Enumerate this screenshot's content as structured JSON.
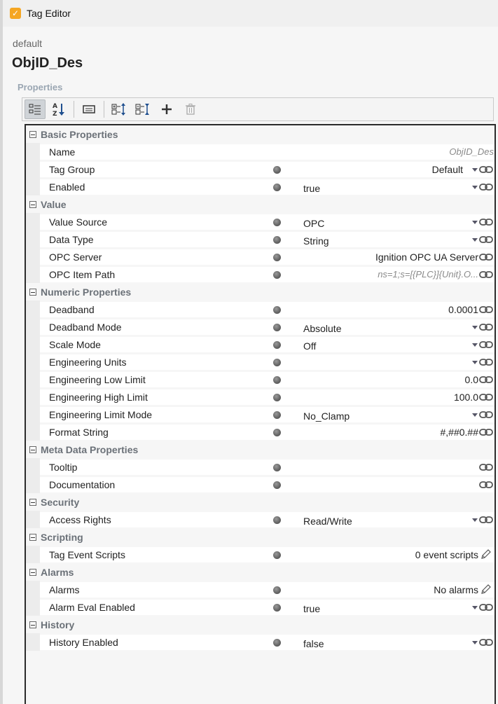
{
  "window": {
    "title": "Tag Editor",
    "app_icon_glyph": "✓"
  },
  "header": {
    "provider": "default",
    "tag_name": "ObjID_Des",
    "section_label": "Properties"
  },
  "toolbar": {
    "buttons": [
      {
        "name": "categorized-view-icon",
        "active": true
      },
      {
        "name": "sort-alphabetical-icon",
        "active": false
      },
      {
        "name": "description-toggle-icon",
        "active": false
      },
      {
        "name": "expand-all-icon",
        "active": false
      },
      {
        "name": "collapse-all-icon",
        "active": false
      },
      {
        "name": "add-icon",
        "active": false
      },
      {
        "name": "delete-icon",
        "active": false,
        "disabled": true
      }
    ]
  },
  "categories": [
    {
      "label": "Basic Properties",
      "rows": [
        {
          "name": "Name",
          "value": "ObjID_Des"
        },
        {
          "name": "Tag Group",
          "value": "Default"
        },
        {
          "name": "Enabled",
          "value": "true"
        }
      ]
    },
    {
      "label": "Value",
      "rows": [
        {
          "name": "Value Source",
          "value": "OPC"
        },
        {
          "name": "Data Type",
          "value": "String"
        },
        {
          "name": "OPC Server",
          "value": "Ignition OPC UA Server"
        },
        {
          "name": "OPC Item Path",
          "value": "ns=1;s=[{PLC}]{Unit}.O..."
        }
      ]
    },
    {
      "label": "Numeric Properties",
      "rows": [
        {
          "name": "Deadband",
          "value": "0.0001"
        },
        {
          "name": "Deadband Mode",
          "value": "Absolute"
        },
        {
          "name": "Scale Mode",
          "value": "Off"
        },
        {
          "name": "Engineering Units",
          "value": ""
        },
        {
          "name": "Engineering Low Limit",
          "value": "0.0"
        },
        {
          "name": "Engineering High Limit",
          "value": "100.0"
        },
        {
          "name": "Engineering Limit Mode",
          "value": "No_Clamp"
        },
        {
          "name": "Format String",
          "value": "#,##0.##"
        }
      ]
    },
    {
      "label": "Meta Data Properties",
      "rows": [
        {
          "name": "Tooltip",
          "value": ""
        },
        {
          "name": "Documentation",
          "value": ""
        }
      ]
    },
    {
      "label": "Security",
      "rows": [
        {
          "name": "Access Rights",
          "value": "Read/Write"
        }
      ]
    },
    {
      "label": "Scripting",
      "rows": [
        {
          "name": "Tag Event Scripts",
          "value": "0 event scripts"
        }
      ]
    },
    {
      "label": "Alarms",
      "rows": [
        {
          "name": "Alarms",
          "value": "No alarms"
        },
        {
          "name": "Alarm Eval Enabled",
          "value": "true"
        }
      ]
    },
    {
      "label": "History",
      "rows": [
        {
          "name": "History Enabled",
          "value": "false"
        }
      ]
    }
  ],
  "colors": {
    "accent": "#f5a623",
    "category_text": "#6b7178",
    "section_label": "#9aa6b2"
  }
}
